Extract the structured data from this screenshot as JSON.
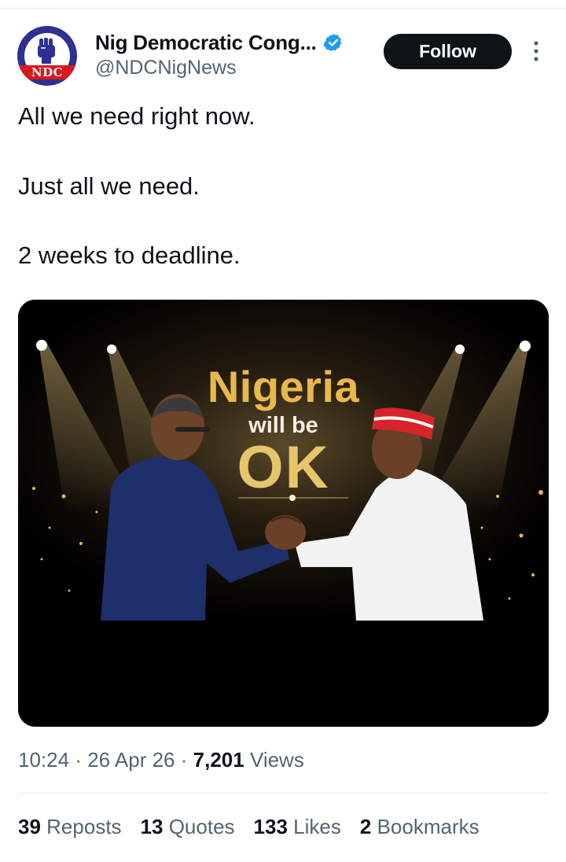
{
  "author": {
    "display_name": "Nig Democratic Cong...",
    "handle": "@NDCNigNews",
    "avatar_text": "NDC",
    "verified": true
  },
  "actions": {
    "follow_label": "Follow"
  },
  "tweet": {
    "lines": [
      "All we need right now.",
      "Just all we need.",
      "2 weeks to deadline."
    ]
  },
  "media": {
    "headline": "Nigeria",
    "subline": "will be",
    "ok": "OK"
  },
  "meta": {
    "time": "10:24",
    "date": "26 Apr 26",
    "views_count": "7,201",
    "views_label": "Views"
  },
  "stats": [
    {
      "count": "39",
      "label": "Reposts"
    },
    {
      "count": "13",
      "label": "Quotes"
    },
    {
      "count": "133",
      "label": "Likes"
    },
    {
      "count": "2",
      "label": "Bookmarks"
    }
  ],
  "colors": {
    "accent": "#1d9bf0",
    "follow_bg": "#0f1419",
    "muted_text": "#536471",
    "gold": "#e8b84a"
  }
}
